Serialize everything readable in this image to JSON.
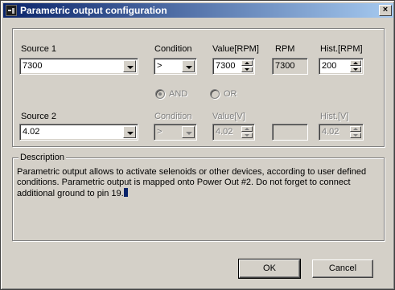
{
  "window": {
    "title": "Parametric output configuration",
    "close_symbol": "×"
  },
  "source1": {
    "label": "Source 1",
    "value": "7300",
    "condition_label": "Condition",
    "condition_value": ">",
    "value_label": "Value[RPM]",
    "live_label": "RPM",
    "live_value": "7300",
    "hist_label": "Hist.[RPM]",
    "hist_value": "200"
  },
  "logic": {
    "and_label": "AND",
    "or_label": "OR",
    "selected": "AND"
  },
  "source2": {
    "label": "Source 2",
    "value": "4.02",
    "condition_label": "Condition",
    "condition_value": ">",
    "value_label": "Value[V]",
    "live_value": "",
    "hist_label": "Hist.[V]",
    "hist_value": "4.02"
  },
  "description": {
    "legend": "Description",
    "text": "Parametric output allows to activate selenoids or other devices, according to user defined conditions. Parametric output is mapped onto Power Out #2. Do not forget to connect additional ground to pin 19."
  },
  "buttons": {
    "ok_label": "OK",
    "cancel_label": "Cancel"
  },
  "icons": {
    "window": "app-icon",
    "close": "close-icon",
    "combo": "chevron-down-icon",
    "spin_up": "spin-up-icon",
    "spin_down": "spin-down-icon"
  }
}
